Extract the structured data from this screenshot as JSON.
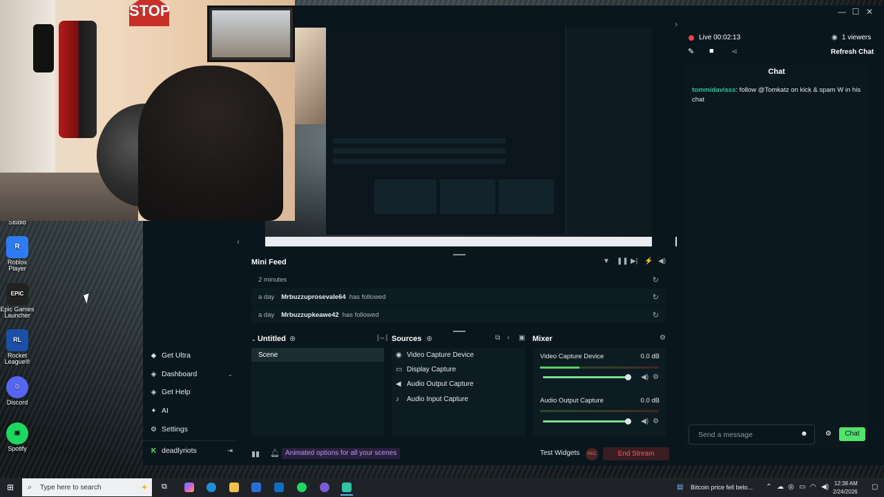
{
  "desktop_icons": [
    {
      "label": "Studio",
      "glyph": ""
    },
    {
      "label": "Roblox Player",
      "glyph": "R"
    },
    {
      "label": "Epic Games Launcher",
      "glyph": "EPIC"
    },
    {
      "label": "Rocket League®",
      "glyph": "RL"
    },
    {
      "label": "Discord",
      "glyph": "☺"
    },
    {
      "label": "Spotify",
      "glyph": "≋"
    }
  ],
  "webcam": {
    "sign_text": "STOP"
  },
  "nav": {
    "items": [
      {
        "label": "Get Ultra",
        "icon": "ultra-icon"
      },
      {
        "label": "Dashboard",
        "icon": "dashboard-icon"
      },
      {
        "label": "Get Help",
        "icon": "help-icon"
      },
      {
        "label": "AI",
        "icon": "ai-icon"
      },
      {
        "label": "Settings",
        "icon": "gear-icon"
      }
    ],
    "user": "deadlyriots"
  },
  "mini_feed": {
    "title": "Mini Feed",
    "rows": [
      {
        "time": "2 minutes",
        "name": "",
        "action": ""
      },
      {
        "time": "a day",
        "name": "Mrbuzzuprosevale64",
        "action": "has followed"
      },
      {
        "time": "a day",
        "name": "Mrbuzzupkeawe42",
        "action": "has followed"
      }
    ]
  },
  "scenes": {
    "title": "Untitled",
    "items": [
      "Scene"
    ]
  },
  "sources": {
    "title": "Sources",
    "items": [
      "Video Capture Device",
      "Display Capture",
      "Audio Output Capture",
      "Audio Input Capture"
    ]
  },
  "mixer": {
    "title": "Mixer",
    "channels": [
      {
        "name": "Video Capture Device",
        "db": "0.0 dB",
        "level": 0.33
      },
      {
        "name": "Audio Output Capture",
        "db": "0.0 dB",
        "level": 0.0
      }
    ]
  },
  "bottom": {
    "promo": "Animated options for all your scenes",
    "test_widgets": "Test Widgets",
    "rec": "REC",
    "end_stream": "End Stream"
  },
  "chat": {
    "live": "Live 00:02:13",
    "viewers": "1 viewers",
    "refresh": "Refresh Chat",
    "title": "Chat",
    "messages": [
      {
        "user": "tommidavisss",
        "text": ": follow @Tomkatz on kick & spam W in his chat"
      }
    ],
    "input_placeholder": "Send a message",
    "send": "Chat"
  },
  "taskbar": {
    "search_placeholder": "Type here to search",
    "news": "Bitcoin price fell belo...",
    "time": "12:38 AM",
    "date": "2/24/2026"
  },
  "colors": {
    "accent": "#53e36a",
    "end_stream": "#ff5a63",
    "promo": "#b79af0",
    "username": "#31c3a2"
  }
}
